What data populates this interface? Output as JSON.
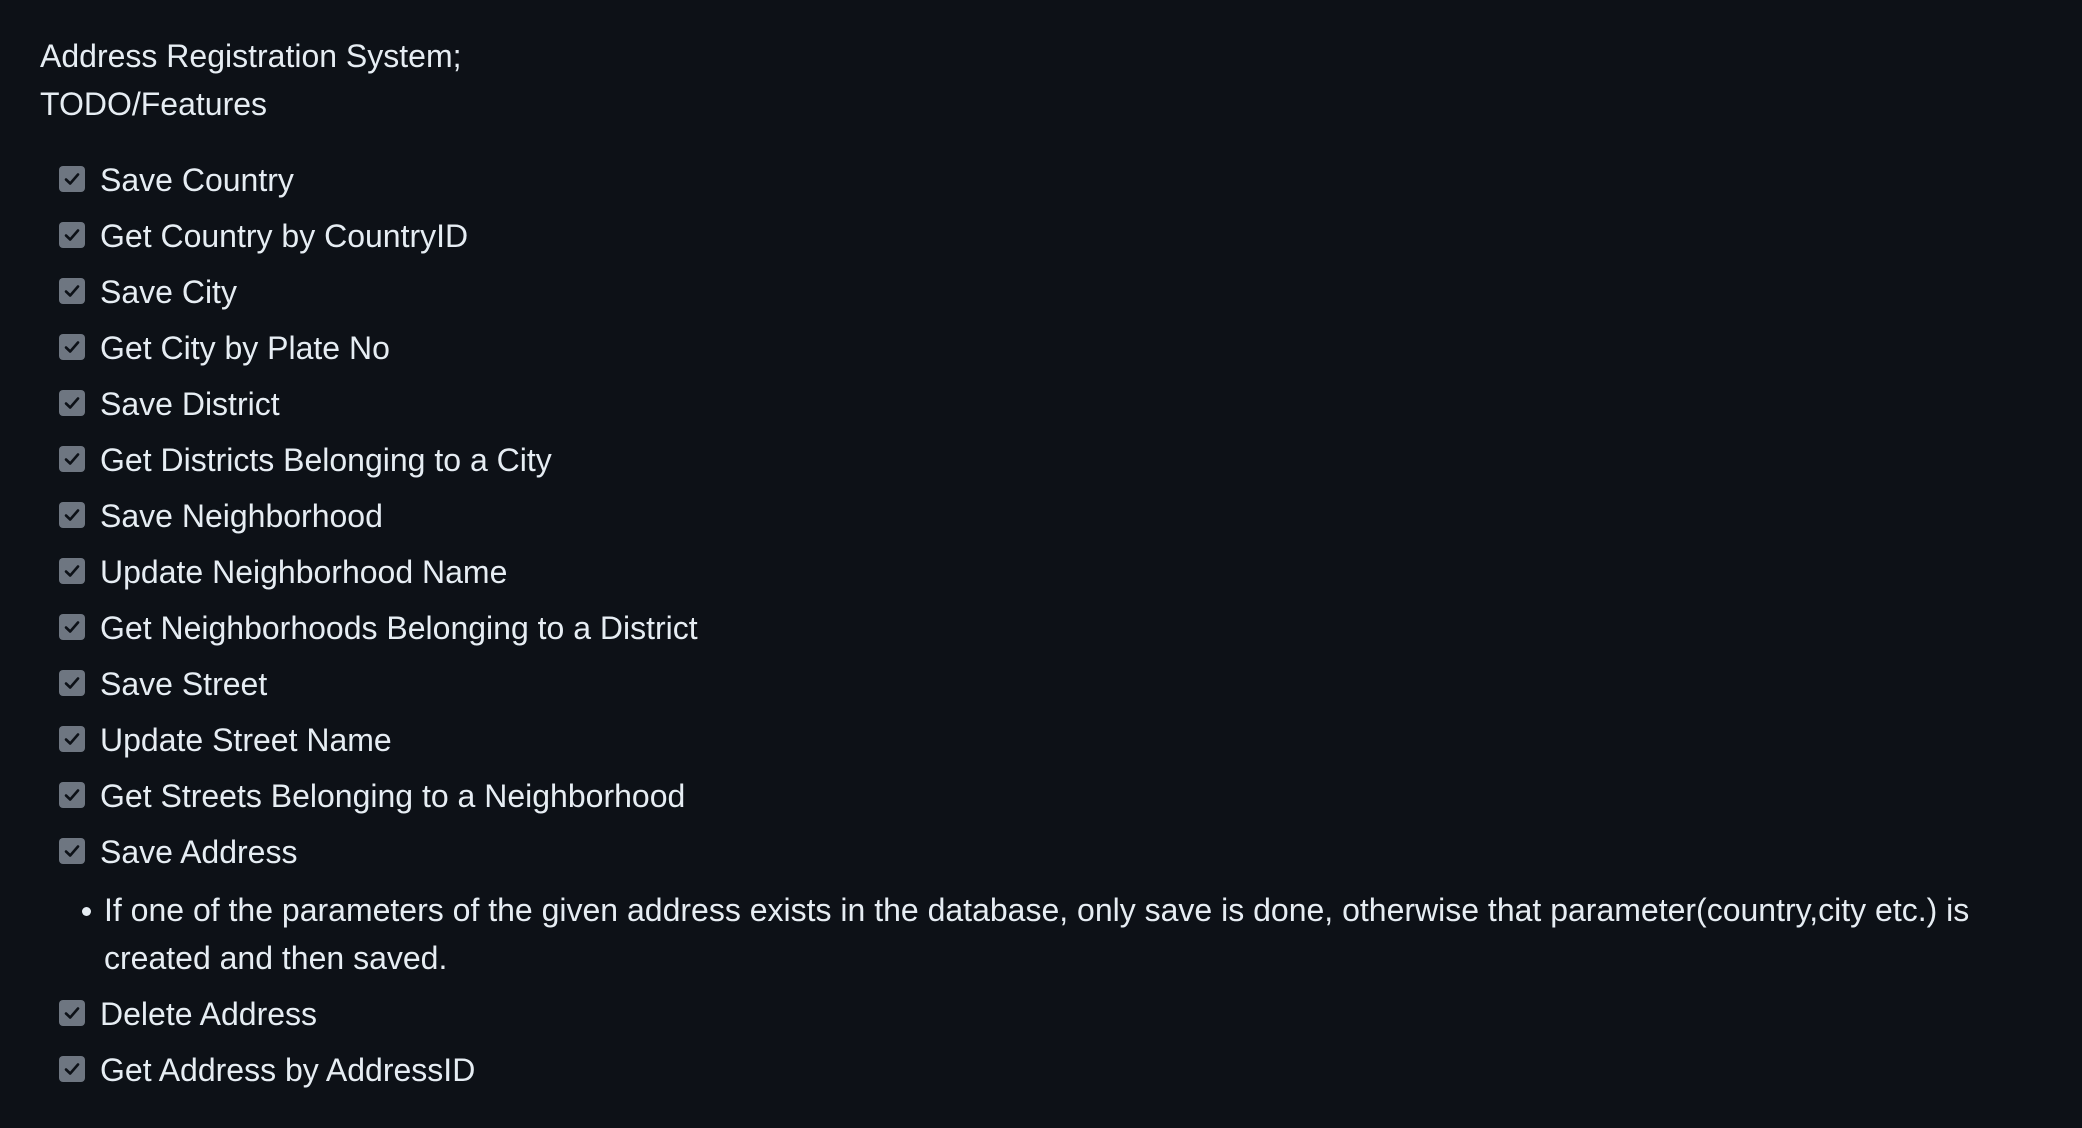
{
  "heading": {
    "line1": "Address Registration System;",
    "line2": "TODO/Features"
  },
  "tasks_before": [
    {
      "label": "Save Country",
      "checked": true
    },
    {
      "label": "Get Country by CountryID",
      "checked": true
    },
    {
      "label": "Save City",
      "checked": true
    },
    {
      "label": "Get City by Plate No",
      "checked": true
    },
    {
      "label": "Save District",
      "checked": true
    },
    {
      "label": "Get Districts Belonging to a City",
      "checked": true
    },
    {
      "label": "Save Neighborhood",
      "checked": true
    },
    {
      "label": "Update Neighborhood Name",
      "checked": true
    },
    {
      "label": "Get Neighborhoods Belonging to a District",
      "checked": true
    },
    {
      "label": "Save Street",
      "checked": true
    },
    {
      "label": "Update Street Name",
      "checked": true
    },
    {
      "label": "Get Streets Belonging to a Neighborhood",
      "checked": true
    },
    {
      "label": "Save Address",
      "checked": true
    }
  ],
  "note": {
    "text": "If one of the parameters of the given address exists in the database, only save is done, otherwise that parameter(country,city etc.) is created and then saved."
  },
  "tasks_after": [
    {
      "label": "Delete Address",
      "checked": true
    },
    {
      "label": "Get Address by AddressID",
      "checked": true
    }
  ],
  "colors": {
    "background": "#0d1117",
    "text": "#e6edf3",
    "checkbox_disabled": "#6e7681"
  }
}
